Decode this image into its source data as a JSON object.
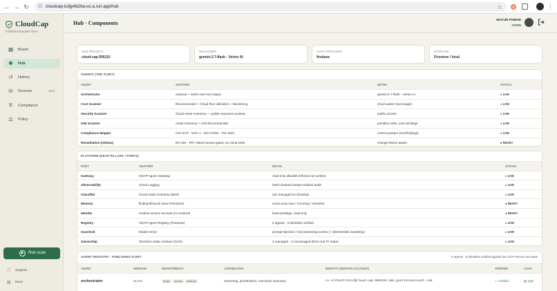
{
  "browser": {
    "url": "cloudcap-lu3jp4b2ba-uc.a.run.app/hub"
  },
  "sidebar": {
    "brand": "CloudCap",
    "tagline": "Fortified Enterprise Fleet",
    "items": [
      {
        "label": "Board",
        "icon": "grid-icon"
      },
      {
        "label": "Hub",
        "icon": "hub-icon",
        "active": true
      },
      {
        "label": "History",
        "icon": "history-icon"
      },
      {
        "label": "Sources",
        "icon": "database-icon",
        "count": "2/10"
      },
      {
        "label": "Compliance",
        "icon": "shield-icon"
      },
      {
        "label": "Policy",
        "icon": "scales-icon"
      }
    ],
    "run_scan": "Run scan",
    "support": "Support",
    "docs": "Docs"
  },
  "header": {
    "title": "Hub · Components",
    "user_name": "MAYUR PAWAR",
    "user_role": "ADMIN"
  },
  "summary": [
    {
      "label": "HUB PROJECT",
      "value": "cloud-cap-506110"
    },
    {
      "label": "REASONER",
      "value": "gemini-3.7-flash · Vertex AI"
    },
    {
      "label": "AUTH PROVIDER",
      "value": "firebase"
    },
    {
      "label": "STORAGE",
      "value": "Firestore / local"
    }
  ],
  "agents": {
    "title": "AGENTS (THE FLEET)",
    "columns": [
      "AGENT",
      "ADAPTER",
      "DETAIL",
      "STATUS"
    ],
    "rows": [
      {
        "name": "Orchestrator",
        "adapter": "reasons + ranks over tool output",
        "detail": "gemini-3.7-flash · Vertex AI",
        "status": "LIVE"
      },
      {
        "name": "Cost Scanner",
        "adapter": "Recommender + Cloud Run utilization + Monitoring",
        "detail": "cloud waste (real usage)",
        "status": "LIVE"
      },
      {
        "name": "Security Scanner",
        "adapter": "Cloud Asset Inventory — public-exposure posture",
        "detail": "public access",
        "status": "LIVE"
      },
      {
        "name": "IAM Scanner",
        "adapter": "Asset Inventory + IAM Recommender",
        "detail": "primitive roles, over-privilege",
        "status": "LIVE"
      },
      {
        "name": "Compliance Mapper",
        "adapter": "CIS GCP · SOC 2 · ISO 27001 · PCI DSS",
        "detail": "control posture (real findings)",
        "status": "LIVE"
      },
      {
        "name": "Remediation (GitOps)",
        "adapter": "IRA live · PR / Slack human-gated, no cloud write",
        "detail": "change-freeze aware",
        "status": "READY"
      }
    ]
  },
  "platform": {
    "title": "PLATFORM (GEAP PILLARS / PORTS)",
    "columns": [
      "PORT",
      "ADAPTER",
      "DETAIL",
      "STATUS"
    ],
    "rows": [
      {
        "name": "Gateway",
        "adapter": "GEAP Agent Gateway",
        "detail": "read-only allowlist enforced at runtime",
        "status": "LIVE"
      },
      {
        "name": "Observability",
        "adapter": "Cloud Logging",
        "detail": "hash-chained tamper-evident audit",
        "status": "LIVE"
      },
      {
        "name": "Classifier",
        "adapter": "Cloud Asset Inventory labels",
        "detail": "IaC-managed vs ClickOps",
        "status": "LIVE"
      },
      {
        "name": "Memory",
        "adapter": "finding-lifecycle store (Firestore)",
        "detail": "cross-scan new / recurring / resolved",
        "status": "READY"
      },
      {
        "name": "Identity",
        "adapter": "runtime service account (cc-runtime)",
        "detail": "least-privilege, read-only",
        "status": "READY"
      },
      {
        "name": "Registry",
        "adapter": "GEAP Agent Registry (Firestore)",
        "detail": "6 agents · 6 identities verified",
        "status": "LIVE"
      },
      {
        "name": "Guardrail",
        "adapter": "Model Armor",
        "detail": "prompt-injection / tool-poisoning screen (+ deterministic backstop)",
        "status": "LIVE"
      },
      {
        "name": "Ownership",
        "adapter": "Terraform state resolver (GCS)",
        "detail": "2 managed · 3 unmanaged (from real TF state)",
        "status": "LIVE"
      }
    ]
  },
  "registry": {
    "title": "AGENT REGISTRY · PUBLISHED FLEET",
    "summary": "6 agents · 6 identities verified against live GCP service accounts",
    "columns": [
      "AGENT",
      "VERSION",
      "DEPARTMENTS",
      "CAPABILITIES",
      "IDENTITY (SERVICE ACCOUNT)",
      "VERIFIED",
      "LOGS"
    ],
    "rows": [
      {
        "name": "orchestrator",
        "version": "v1.0.0",
        "departments": [
          "finops",
          "secops",
          "platform"
        ],
        "capabilities": "reasoning, prioritization, executive summary",
        "identity": "cc-orchestrator@cloud-cap-506110.iam.gserviceaccount.com",
        "verified": "verified",
        "logs": "logs"
      }
    ]
  },
  "colors": {
    "accent": "#2e6d4c",
    "live": "#2f7a52",
    "ready": "#1f2a24",
    "background": "#f4f2ec"
  }
}
